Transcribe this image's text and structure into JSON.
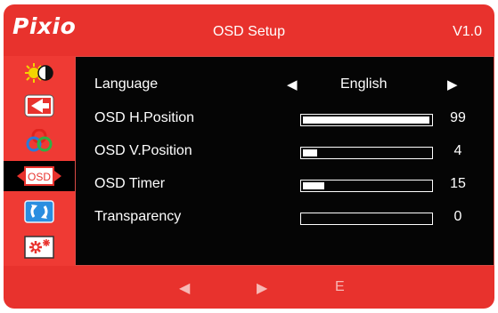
{
  "header": {
    "logo": "Pixio",
    "title": "OSD Setup",
    "version": "V1.0"
  },
  "sidebar": {
    "items": [
      {
        "name": "brightness-contrast",
        "icon": "sun-contrast-icon"
      },
      {
        "name": "image",
        "icon": "image-position-icon"
      },
      {
        "name": "color",
        "icon": "rgb-color-icon"
      },
      {
        "name": "osd-setup",
        "icon": "osd-icon",
        "label": "OSD",
        "active": true
      },
      {
        "name": "reset",
        "icon": "reset-arrows-icon"
      },
      {
        "name": "misc",
        "icon": "misc-settings-icon"
      }
    ]
  },
  "settings": {
    "language": {
      "label": "Language",
      "value": "English"
    },
    "osd_h_position": {
      "label": "OSD H.Position",
      "value": "99",
      "level": 0.99
    },
    "osd_v_position": {
      "label": "OSD V.Position",
      "value": "4",
      "level": 0.11
    },
    "osd_timer": {
      "label": "OSD Timer",
      "value": "15",
      "level": 0.17
    },
    "transparency": {
      "label": "Transparency",
      "value": "0",
      "level": 0
    }
  },
  "footer": {
    "left": "◀",
    "right": "▶",
    "exit": "E"
  },
  "colors": {
    "background": "#e8322d",
    "panel": "#050505",
    "text": "#ffffff",
    "footer_text": "#f7b8b5"
  }
}
